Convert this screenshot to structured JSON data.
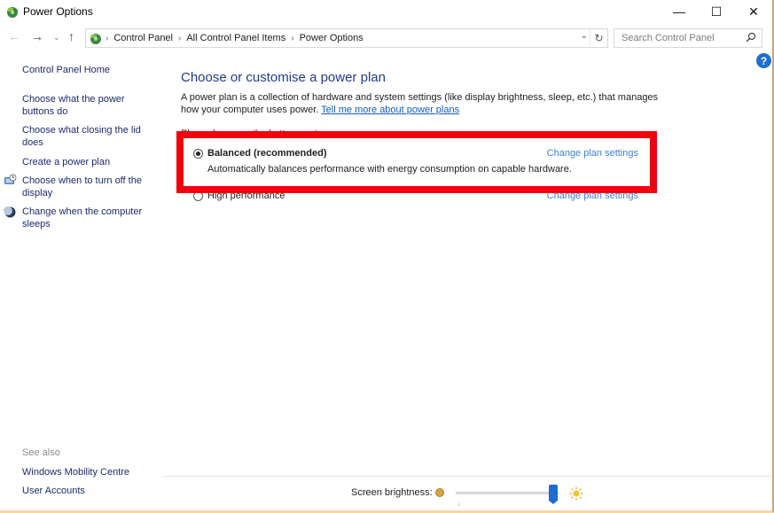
{
  "window": {
    "title": "Power Options",
    "controls": {
      "minimize": "—",
      "maximize": "☐",
      "close": "✕"
    }
  },
  "navigation": {
    "back": "←",
    "forward": "→",
    "recent": "⌄",
    "up": "↑",
    "breadcrumbs": [
      "Control Panel",
      "All Control Panel Items",
      "Power Options"
    ],
    "separator": "›",
    "dropdown": "⌄",
    "refresh": "↻",
    "search_placeholder": "Search Control Panel"
  },
  "help": {
    "label": "?"
  },
  "sidebar": {
    "home": "Control Panel Home",
    "items": [
      {
        "label": "Choose what the power buttons do",
        "icon": null
      },
      {
        "label": "Choose what closing the lid does",
        "icon": null
      },
      {
        "label": "Create a power plan",
        "icon": null
      },
      {
        "label": "Choose when to turn off the display",
        "icon": "display-clock-icon"
      },
      {
        "label": "Change when the computer sleeps",
        "icon": "moon-sleep-icon"
      }
    ],
    "see_also_label": "See also",
    "see_also": [
      "Windows Mobility Centre",
      "User Accounts"
    ]
  },
  "main": {
    "heading": "Choose or customise a power plan",
    "description": "A power plan is a collection of hardware and system settings (like display brightness, sleep, etc.) that manages how your computer uses power.",
    "learn_more_link": "Tell me more about power plans",
    "section_label": "Plans shown on the battery meter",
    "plans": [
      {
        "name": "Balanced (recommended)",
        "selected": true,
        "description": "Automatically balances performance with energy consumption on capable hardware.",
        "link": "Change plan settings"
      },
      {
        "name": "High performance",
        "selected": false,
        "link": "Change plan settings"
      }
    ],
    "highlight_color": "#f2000e"
  },
  "footer": {
    "brightness_label": "Screen brightness:",
    "brightness_percent": 95
  }
}
